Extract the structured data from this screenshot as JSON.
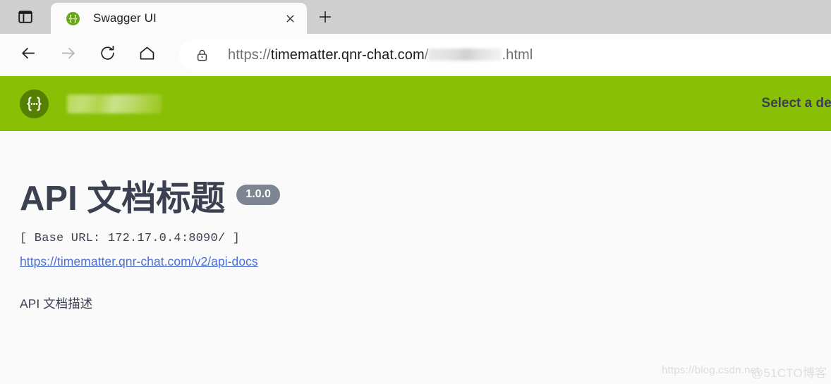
{
  "browser": {
    "tab_actions_icon": "split-screen-icon",
    "tab": {
      "favicon": "swagger-braces-icon",
      "title": "Swagger UI",
      "close_icon": "close-icon"
    },
    "new_tab_icon": "plus-icon",
    "nav": {
      "back_icon": "arrow-left-icon",
      "forward_icon": "arrow-right-icon",
      "reload_icon": "reload-icon",
      "home_icon": "home-icon"
    },
    "omnibox": {
      "lock_icon": "lock-icon",
      "url_scheme": "https://",
      "url_host": "timematter.qnr-chat.com",
      "url_sep": "/",
      "url_redacted_note": "redacted",
      "url_tail": ".html"
    }
  },
  "swagger": {
    "topbar": {
      "logo_icon": "swagger-braces-icon",
      "logo_text_note": "redacted",
      "select_definition_label": "Select a definition"
    },
    "title": "API 文档标题",
    "version": "1.0.0",
    "base_url": "[ Base URL: 172.17.0.4:8090/ ]",
    "docs_link": "https://timematter.qnr-chat.com/v2/api-docs",
    "description": "API 文档描述"
  },
  "watermarks": {
    "csdn": "https://blog.csdn.net",
    "cto": "@51CTO博客"
  }
}
